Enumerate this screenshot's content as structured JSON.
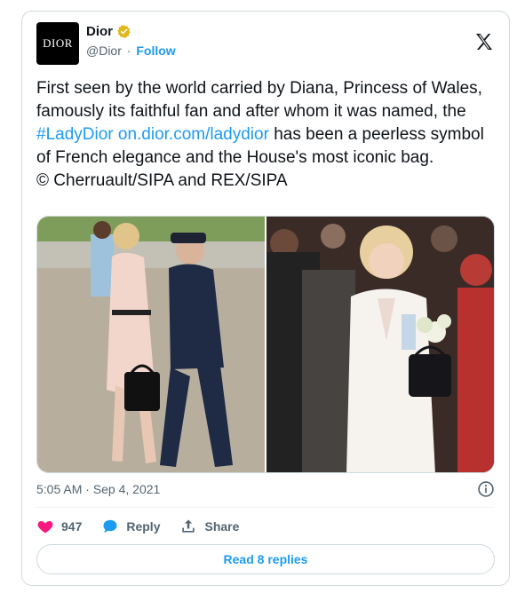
{
  "author": {
    "display_name": "Dior",
    "handle": "@Dior",
    "separator": "·",
    "follow_label": "Follow",
    "avatar_text": "DIOR"
  },
  "tweet": {
    "text_part1": "First seen by the world carried by Diana, Princess of Wales, famously its faithful fan and after whom it was named, the ",
    "hashtag": "#LadyDior",
    "space": " ",
    "link": "on.dior.com/ladydior",
    "text_part2": " has been a peerless symbol of French elegance and the House's most iconic bag.\n© Cherruault/SIPA and REX/SIPA",
    "timestamp": "5:05 AM · Sep 4, 2021"
  },
  "actions": {
    "like_count": "947",
    "reply_label": "Reply",
    "share_label": "Share",
    "read_replies_label": "Read 8 replies"
  },
  "colors": {
    "accent": "#1d9bf0",
    "like": "#f91880",
    "verified_gold": "#e2b719"
  }
}
